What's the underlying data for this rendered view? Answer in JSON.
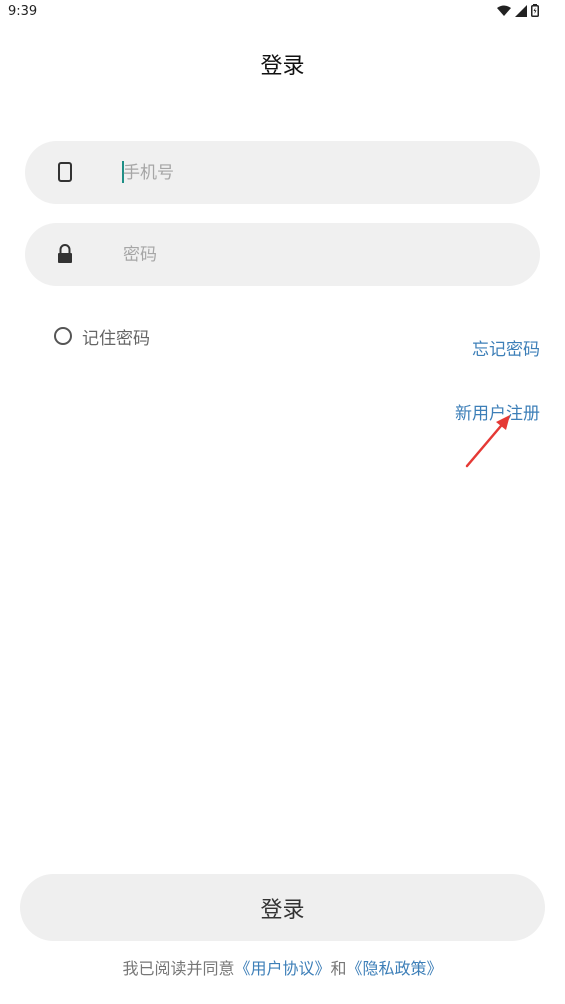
{
  "status_bar": {
    "time": "9:39",
    "icons": [
      "wifi-icon",
      "signal-icon",
      "battery-icon"
    ]
  },
  "header": {
    "title": "登录"
  },
  "form": {
    "phone": {
      "placeholder": "手机号",
      "value": "",
      "icon": "phone-icon"
    },
    "password": {
      "placeholder": "密码",
      "value": "",
      "icon": "lock-icon"
    },
    "remember_label": "记住密码",
    "remember_checked": false
  },
  "links": {
    "forgot_password": "忘记密码",
    "register": "新用户注册"
  },
  "login_button_label": "登录",
  "agreement": {
    "prefix": "我已阅读并同意",
    "user_agreement": "《用户协议》",
    "conjunction": "和",
    "privacy_policy": "《隐私政策》"
  },
  "colors": {
    "link": "#3d7fb8",
    "field_background": "#f0f0f0",
    "caret": "#1e8f86",
    "annotation_arrow": "#e53935"
  }
}
